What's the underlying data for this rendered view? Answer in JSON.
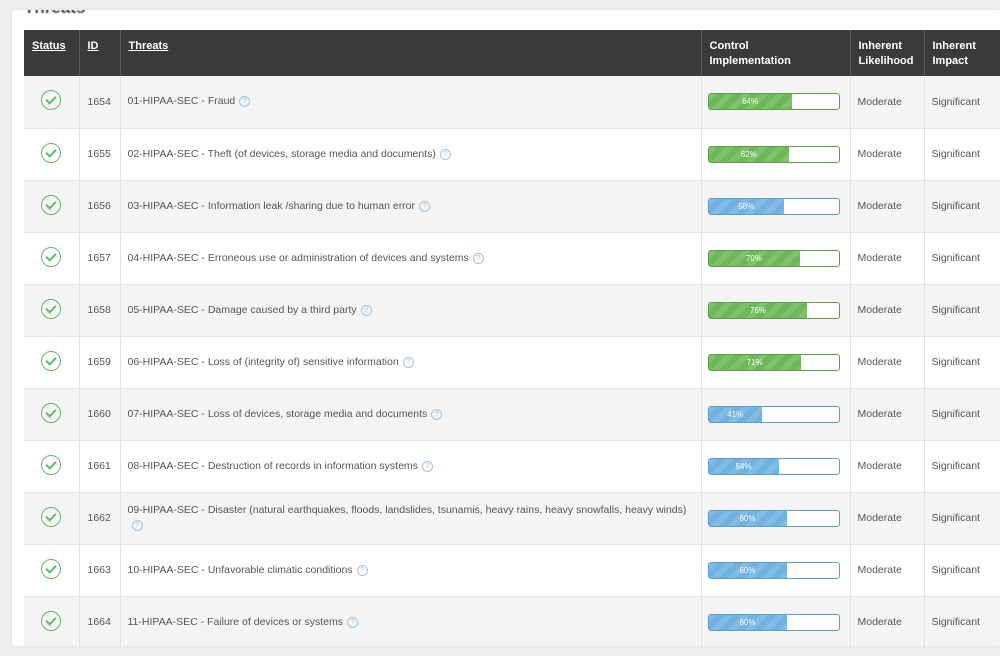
{
  "section": {
    "title": "Threats"
  },
  "table": {
    "headers": {
      "status": "Status",
      "id": "ID",
      "threats": "Threats",
      "control_line1": "Control",
      "control_line2": "Implementation",
      "likelihood_line1": "Inherent",
      "likelihood_line2": "Likelihood",
      "impact_line1": "Inherent",
      "impact_line2": "Impact"
    },
    "help_glyph": "?",
    "rows": [
      {
        "id": "1654",
        "threat": "01-HIPAA-SEC - Fraud",
        "control": 64,
        "control_label": "64%",
        "color": "green",
        "likelihood": "Moderate",
        "impact": "Significant"
      },
      {
        "id": "1655",
        "threat": "02-HIPAA-SEC - Theft (of devices, storage media and documents)",
        "control": 62,
        "control_label": "62%",
        "color": "green",
        "likelihood": "Moderate",
        "impact": "Significant"
      },
      {
        "id": "1656",
        "threat": "03-HIPAA-SEC - Information leak /sharing due to human error",
        "control": 58,
        "control_label": "58%",
        "color": "blue",
        "likelihood": "Moderate",
        "impact": "Significant"
      },
      {
        "id": "1657",
        "threat": "04-HIPAA-SEC - Erroneous use or administration of devices and systems",
        "control": 70,
        "control_label": "70%",
        "color": "green",
        "likelihood": "Moderate",
        "impact": "Significant"
      },
      {
        "id": "1658",
        "threat": "05-HIPAA-SEC - Damage caused by a third party",
        "control": 76,
        "control_label": "76%",
        "color": "green",
        "likelihood": "Moderate",
        "impact": "Significant"
      },
      {
        "id": "1659",
        "threat": "06-HIPAA-SEC - Loss of (integrity of) sensitive information",
        "control": 71,
        "control_label": "71%",
        "color": "green",
        "likelihood": "Moderate",
        "impact": "Significant"
      },
      {
        "id": "1660",
        "threat": "07-HIPAA-SEC - Loss of devices, storage media and documents",
        "control": 41,
        "control_label": "41%",
        "color": "blue",
        "likelihood": "Moderate",
        "impact": "Significant"
      },
      {
        "id": "1661",
        "threat": "08-HIPAA-SEC - Destruction of records in information systems",
        "control": 54,
        "control_label": "54%",
        "color": "blue",
        "likelihood": "Moderate",
        "impact": "Significant"
      },
      {
        "id": "1662",
        "threat": "09-HIPAA-SEC - Disaster (natural earthquakes, floods, landslides, tsunamis, heavy rains, heavy snowfalls, heavy winds)",
        "control": 60,
        "control_label": "60%",
        "color": "blue",
        "likelihood": "Moderate",
        "impact": "Significant"
      },
      {
        "id": "1663",
        "threat": "10-HIPAA-SEC - Unfavorable climatic conditions",
        "control": 60,
        "control_label": "60%",
        "color": "blue",
        "likelihood": "Moderate",
        "impact": "Significant"
      },
      {
        "id": "1664",
        "threat": "11-HIPAA-SEC - Failure of devices or systems",
        "control": 60,
        "control_label": "60%",
        "color": "blue",
        "likelihood": "Moderate",
        "impact": "Significant"
      }
    ]
  }
}
